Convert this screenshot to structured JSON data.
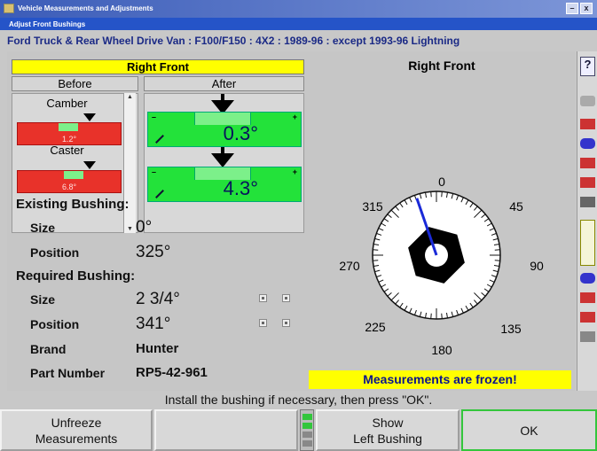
{
  "window": {
    "title": "Vehicle Measurements and Adjustments",
    "subtitle": "Adjust Front Bushings",
    "min_btn": "–",
    "close_btn": "x"
  },
  "vehicle": "Ford Truck & Rear Wheel Drive Van : F100/F150 : 4X2 : 1989-96 : except 1993-96 Lightning",
  "meter": {
    "header": "Right Front",
    "before_label": "Before",
    "after_label": "After",
    "rows": [
      {
        "name": "Camber",
        "before": "1.2°",
        "after": "0.3°"
      },
      {
        "name": "Caster",
        "before": "6.8°",
        "after": "4.3°"
      }
    ]
  },
  "existing": {
    "title": "Existing Bushing:",
    "size_label": "Size",
    "size_value": "0°",
    "position_label": "Position",
    "position_value": "325°"
  },
  "required": {
    "title": "Required Bushing:",
    "size_label": "Size",
    "size_value": "2 3/4°",
    "position_label": "Position",
    "position_value": "341°",
    "brand_label": "Brand",
    "brand_value": "Hunter",
    "part_label": "Part Number",
    "part_value": "RP5-42-961"
  },
  "dial": {
    "title": "Right Front",
    "labels": [
      "0",
      "45",
      "90",
      "135",
      "180",
      "225",
      "270",
      "315"
    ],
    "pointer_deg": 341
  },
  "status": {
    "frozen": "Measurements are frozen!"
  },
  "prompt": "Install the bushing if necessary, then press \"OK\".",
  "softkeys": {
    "k1_line1": "Unfreeze",
    "k1_line2": "Measurements",
    "k2": "",
    "k3_line1": "Show",
    "k3_line2": "Left Bushing",
    "k4": "OK"
  },
  "colors": {
    "header_yellow": "#ffff00",
    "in_spec_green": "#23e23a",
    "out_spec_red": "#e8322a",
    "title_blue": "#2554c8",
    "pointer_blue": "#1a2ad8"
  }
}
